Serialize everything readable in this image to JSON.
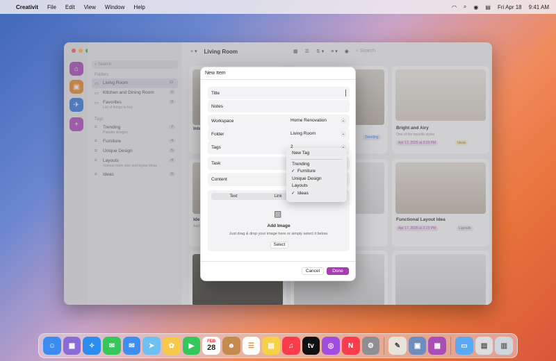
{
  "menubar": {
    "apple": "",
    "app": "Creativit",
    "items": [
      "File",
      "Edit",
      "View",
      "Window",
      "Help"
    ],
    "date": "Fri Apr 18",
    "time": "9:41 AM"
  },
  "window": {
    "title": "Living Room",
    "search_placeholder": "Search",
    "sidebar": {
      "search_placeholder": "Search",
      "folders_header": "Folders",
      "folders": [
        {
          "label": "Living Room",
          "count": "10"
        },
        {
          "label": "Kitchen and Dining Room",
          "count": "6"
        },
        {
          "label": "Favorites",
          "sub": "List of things to buy",
          "count": "0"
        }
      ],
      "tags_header": "Tags",
      "tags": [
        {
          "label": "Trending",
          "sub": "Popular designs",
          "count": "7"
        },
        {
          "label": "Furniture",
          "count": "4"
        },
        {
          "label": "Unique Design",
          "count": "5"
        },
        {
          "label": "Layouts",
          "sub": "Various room plan and layout ideas",
          "count": "4"
        },
        {
          "label": "Ideas",
          "count": "6"
        }
      ]
    },
    "cards": {
      "c1": {
        "title": "Bright and Airy",
        "sub": "One of the favorite styles",
        "date": "Apr 17, 2025 at 3:23 PM",
        "tag": "Ideas"
      },
      "c2": {
        "title": "Functional Layout Idea",
        "date": "Apr 17, 2025 at 3:23 PM",
        "tag": "Layouts"
      },
      "partial_inte": "Inte",
      "partial_ide": "Ide",
      "partial_add": "Add",
      "trending_tag": "Trending"
    }
  },
  "modal": {
    "title": "New Item",
    "title_field": "Title",
    "notes_field": "Notes",
    "workspace_label": "Workspace",
    "workspace_value": "Home Renovation",
    "folder_label": "Folder",
    "folder_value": "Living Room",
    "tags_label": "Tags",
    "tags_value": "2",
    "task_label": "Task",
    "content_label": "Content",
    "segments": [
      "Text",
      "Link",
      ""
    ],
    "add_image": "Add Image",
    "hint": "Just drag & drop your image here or simply select it below.",
    "select": "Select",
    "cancel": "Cancel",
    "done": "Done"
  },
  "tags_menu": {
    "new_tag": "New Tag",
    "items": [
      {
        "label": "Trending",
        "checked": false
      },
      {
        "label": "Furniture",
        "checked": true
      },
      {
        "label": "Unique Design",
        "checked": false
      },
      {
        "label": "Layouts",
        "checked": false
      },
      {
        "label": "Ideas",
        "checked": true
      }
    ],
    "check_glyph": "✓"
  },
  "dock": {
    "calendar_month": "FEB",
    "calendar_day": "28"
  }
}
